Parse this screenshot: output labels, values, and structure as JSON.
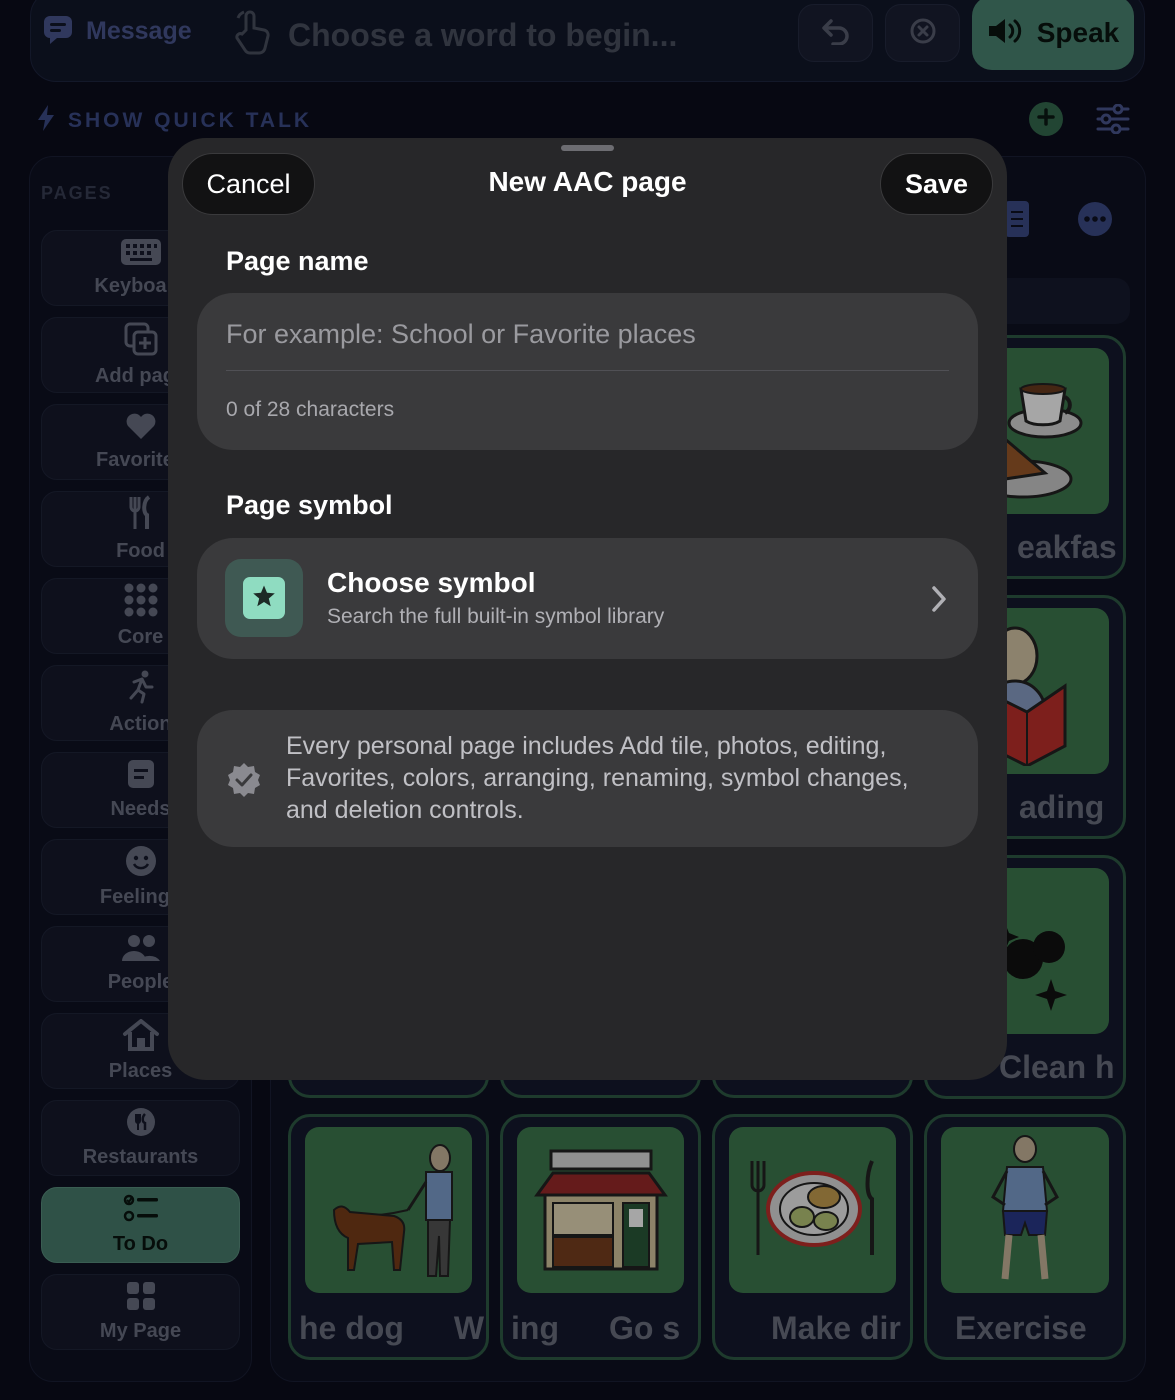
{
  "topbar": {
    "message_label": "Message",
    "prompt": "Choose a word to begin...",
    "speak_label": "Speak"
  },
  "quick_talk": {
    "label": "SHOW QUICK TALK"
  },
  "sidebar": {
    "heading": "PAGES",
    "items": [
      {
        "label": "Keyboard",
        "icon": "keyboard-icon"
      },
      {
        "label": "Add page",
        "icon": "add-page-icon"
      },
      {
        "label": "Favorites",
        "icon": "heart-icon"
      },
      {
        "label": "Food",
        "icon": "fork-knife-icon"
      },
      {
        "label": "Core",
        "icon": "grid-dots-icon"
      },
      {
        "label": "Action",
        "icon": "running-icon"
      },
      {
        "label": "Needs",
        "icon": "note-icon"
      },
      {
        "label": "Feelings",
        "icon": "smile-icon"
      },
      {
        "label": "People",
        "icon": "people-icon"
      },
      {
        "label": "Places",
        "icon": "house-icon"
      },
      {
        "label": "Restaurants",
        "icon": "restaurant-icon"
      },
      {
        "label": "To Do",
        "icon": "checklist-icon",
        "active": true
      },
      {
        "label": "My Page",
        "icon": "squares-icon"
      }
    ]
  },
  "tiles": {
    "right": [
      "eakfas",
      "ading",
      "Clean h"
    ],
    "bottom": [
      "he dog",
      "W",
      "ing",
      "Go s",
      "Make dir",
      "Exercise"
    ]
  },
  "modal": {
    "cancel_label": "Cancel",
    "title": "New AAC page",
    "save_label": "Save",
    "page_name_heading": "Page name",
    "page_name_placeholder": "For example: School or Favorite places",
    "page_name_value": "",
    "char_counter": "0 of 28 characters",
    "page_symbol_heading": "Page symbol",
    "choose_symbol_title": "Choose symbol",
    "choose_symbol_subtitle": "Search the full built-in symbol library",
    "info_text": "Every personal page includes Add tile, photos, editing, Favorites, colors, arranging, renaming, symbol changes, and deletion controls."
  },
  "colors": {
    "accent_green": "#4a8572",
    "modal_bg": "#272729",
    "card_bg": "#3a3a3c",
    "symbol_mint": "#8fdcc1"
  }
}
